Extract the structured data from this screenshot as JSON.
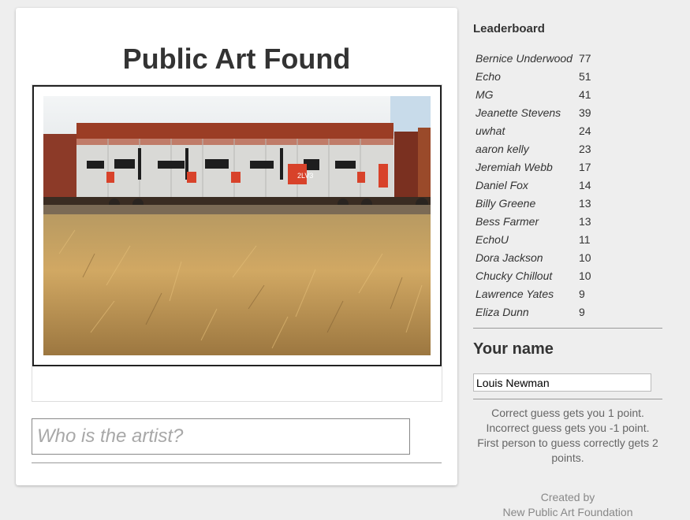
{
  "main": {
    "title": "Public Art Found",
    "photo_alt": "Graffiti-covered boxcar behind dry grass",
    "guess_placeholder": "Who is the artist?"
  },
  "leaderboard": {
    "title": "Leaderboard",
    "entries": [
      {
        "name": "Bernice Underwood",
        "score": "77"
      },
      {
        "name": "Echo",
        "score": "51"
      },
      {
        "name": "MG",
        "score": "41"
      },
      {
        "name": "Jeanette Stevens",
        "score": "39"
      },
      {
        "name": "uwhat",
        "score": "24"
      },
      {
        "name": "aaron kelly",
        "score": "23"
      },
      {
        "name": "Jeremiah Webb",
        "score": "17"
      },
      {
        "name": "Daniel Fox",
        "score": "14"
      },
      {
        "name": "Billy Greene",
        "score": "13"
      },
      {
        "name": "Bess Farmer",
        "score": "13"
      },
      {
        "name": "EchoU",
        "score": "11"
      },
      {
        "name": "Dora Jackson",
        "score": "10"
      },
      {
        "name": "Chucky Chillout",
        "score": "10"
      },
      {
        "name": "Lawrence Yates",
        "score": "9"
      },
      {
        "name": "Eliza Dunn",
        "score": "9"
      }
    ]
  },
  "your_name": {
    "heading": "Your name",
    "value": "Louis Newman"
  },
  "rules": [
    "Correct guess gets you 1 point.",
    "Incorrect guess gets you -1 point.",
    "First person to guess correctly gets 2 points."
  ],
  "footer": {
    "created_by": "Created by",
    "org": "New Public Art Foundation"
  }
}
